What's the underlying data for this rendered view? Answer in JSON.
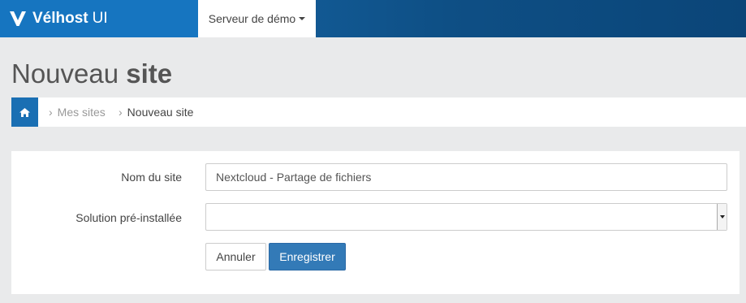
{
  "navbar": {
    "brand_bold": "Vélhost",
    "brand_light": "UI",
    "server_selector": "Serveur de démo",
    "accent": "#1675c0"
  },
  "page": {
    "title_light": "Nouveau",
    "title_bold": "site"
  },
  "breadcrumb": {
    "home_icon": "home-icon",
    "items": [
      "Mes sites",
      "Nouveau site"
    ]
  },
  "form": {
    "site_name_label": "Nom du site",
    "site_name_value": "Nextcloud - Partage de fichiers",
    "solution_label": "Solution pré-installée",
    "solution_value": "",
    "cancel_label": "Annuler",
    "save_label": "Enregistrer"
  }
}
